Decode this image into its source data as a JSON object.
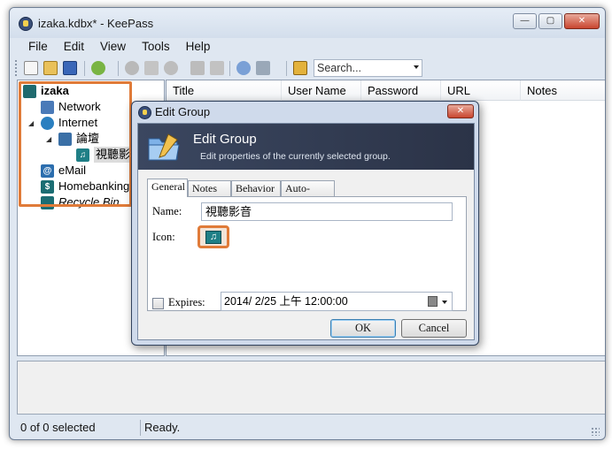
{
  "window": {
    "title": "izaka.kdbx* - KeePass",
    "controls": {
      "minimize": "—",
      "maximize": "▢",
      "close": "✕"
    }
  },
  "menubar": [
    "File",
    "Edit",
    "View",
    "Tools",
    "Help"
  ],
  "toolbar": {
    "search_placeholder": "Search...",
    "icons": [
      "new-database-icon",
      "open-database-icon",
      "save-icon",
      "add-entry-icon",
      "user-icon",
      "copy-username-icon",
      "copy-password-icon",
      "key-icon",
      "edit-entry-icon",
      "delete-entry-icon",
      "find-icon",
      "lock-workspace-icon"
    ]
  },
  "tree": {
    "items": [
      {
        "label": "izaka",
        "icon": "database-icon",
        "bold": true
      },
      {
        "label": "Network",
        "icon": "network-icon"
      },
      {
        "label": "Internet",
        "icon": "globe-icon"
      },
      {
        "label": "論壇",
        "icon": "forum-icon"
      },
      {
        "label": "視聽影音",
        "icon": "music-icon"
      },
      {
        "label": "eMail",
        "icon": "email-icon"
      },
      {
        "label": "Homebanking",
        "icon": "dollar-icon"
      },
      {
        "label": "Recycle Bin",
        "icon": "recycle-bin-icon",
        "italic": true
      }
    ]
  },
  "entry_columns": [
    "Title",
    "User Name",
    "Password",
    "URL",
    "Notes"
  ],
  "status": {
    "selected": "0 of 0 selected",
    "state": "Ready."
  },
  "dialog": {
    "title": "Edit Group",
    "banner_title": "Edit Group",
    "banner_subtitle": "Edit properties of the currently selected group.",
    "tabs": [
      "General",
      "Notes",
      "Behavior",
      "Auto-Type"
    ],
    "active_tab": "General",
    "name_label": "Name:",
    "name_value": "視聽影音",
    "icon_label": "Icon:",
    "expires_label": "Expires:",
    "expires_checked": false,
    "expires_value": "2014/  2/25 上午 12:00:00",
    "ok_label": "OK",
    "cancel_label": "Cancel"
  },
  "colors": {
    "highlight": "#e07b39",
    "banner": "#2e3950"
  }
}
